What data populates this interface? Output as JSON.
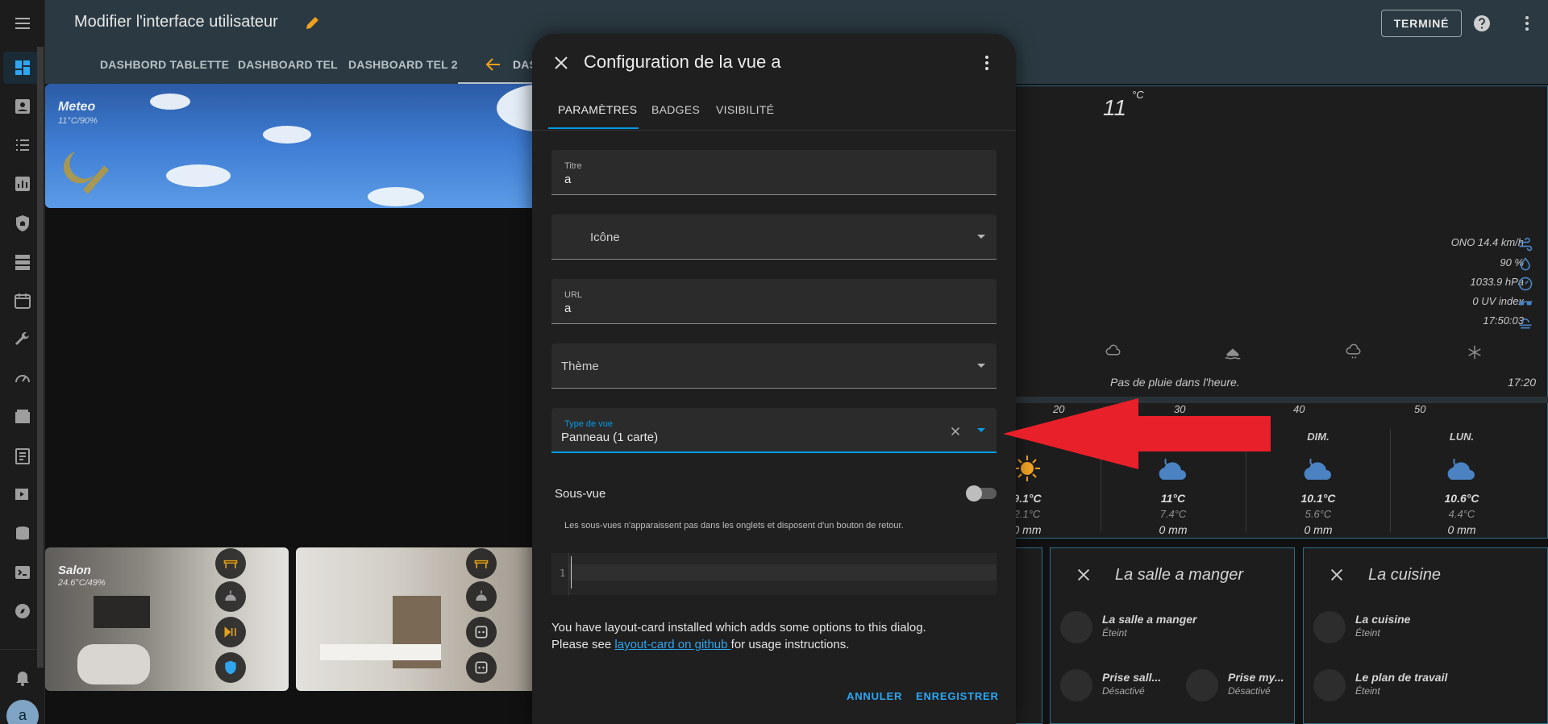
{
  "topbar": {
    "title": "Modifier l'interface utilisateur",
    "tabs": [
      "DASHBORD TABLETTE",
      "DASHBOARD TEL",
      "DASHBOARD TEL 2",
      "DAS"
    ],
    "done_label": "TERMINÉ"
  },
  "sidebar": {
    "icons": [
      "menu-icon",
      "dashboard-icon",
      "account-box-icon",
      "list-icon",
      "chart-icon",
      "shield-home-icon",
      "server-icon",
      "calendar-icon",
      "wrench-icon",
      "speedometer-icon",
      "hacs-icon",
      "log-icon",
      "media-icon",
      "database-icon",
      "terminal-icon",
      "compass-icon",
      "bell-icon"
    ],
    "avatar_letter": "a"
  },
  "meteo_card": {
    "title": "Meteo",
    "subtitle": "11°C/90%"
  },
  "photo_cards": [
    {
      "title": "Salon",
      "subtitle": "24.6°C/49%"
    },
    {
      "title": "",
      "subtitle": ""
    }
  ],
  "weather": {
    "temp": "11",
    "unit": "°C",
    "rows": [
      "ONO 14.4 km/h",
      "90 %",
      "1033.9 hPa",
      "0 UV index",
      "17:50:03"
    ],
    "rain_text": "Pas de pluie dans l'heure.",
    "rain_time": "17:20",
    "scale_labels": [
      "20",
      "30",
      "40",
      "50"
    ],
    "forecast": [
      {
        "day": "",
        "hi": "9.1°C",
        "lo": "2.1°C",
        "rain": "0 mm"
      },
      {
        "day": "",
        "hi": "11°C",
        "lo": "7.4°C",
        "rain": "0 mm"
      },
      {
        "day": "DIM.",
        "hi": "10.1°C",
        "lo": "5.6°C",
        "rain": "0 mm"
      },
      {
        "day": "LUN.",
        "hi": "10.6°C",
        "lo": "4.4°C",
        "rain": "0 mm"
      }
    ]
  },
  "rooms": [
    {
      "title": "La salle a manger",
      "entities": [
        {
          "name": "La salle a manger",
          "state": "Éteint"
        },
        {
          "name": "Prise sall...",
          "state": "Désactivé"
        },
        {
          "name": "Prise my...",
          "state": "Désactivé"
        }
      ]
    },
    {
      "title": "La cuisine",
      "entities": [
        {
          "name": "La cuisine",
          "state": "Éteint"
        },
        {
          "name": "Le plan de travail",
          "state": "Éteint"
        }
      ]
    }
  ],
  "dialog": {
    "title": "Configuration de la vue a",
    "tabs": [
      "PARAMÈTRES",
      "BADGES",
      "VISIBILITÉ"
    ],
    "fields": {
      "title_label": "Titre",
      "title_value": "a",
      "icon_placeholder": "Icône",
      "url_label": "URL",
      "url_value": "a",
      "theme_placeholder": "Thème",
      "view_type_label": "Type de vue",
      "view_type_value": "Panneau (1 carte)"
    },
    "subview_label": "Sous-vue",
    "subview_on": false,
    "subview_helper": "Les sous-vues n'apparaissent pas dans les onglets et disposent d'un bouton de retour.",
    "code_line_no": "1",
    "info_line1": "You have layout-card installed which adds some options to this dialog.",
    "info_line2_pre": "Please see ",
    "info_link": "layout-card on github ",
    "info_line2_post": "for usage instructions.",
    "cancel_label": "ANNULER",
    "save_label": "ENREGISTRER"
  },
  "colors": {
    "accent": "#039be5",
    "topbar": "#2b3a42",
    "annotation_arrow": "#e8202a"
  }
}
